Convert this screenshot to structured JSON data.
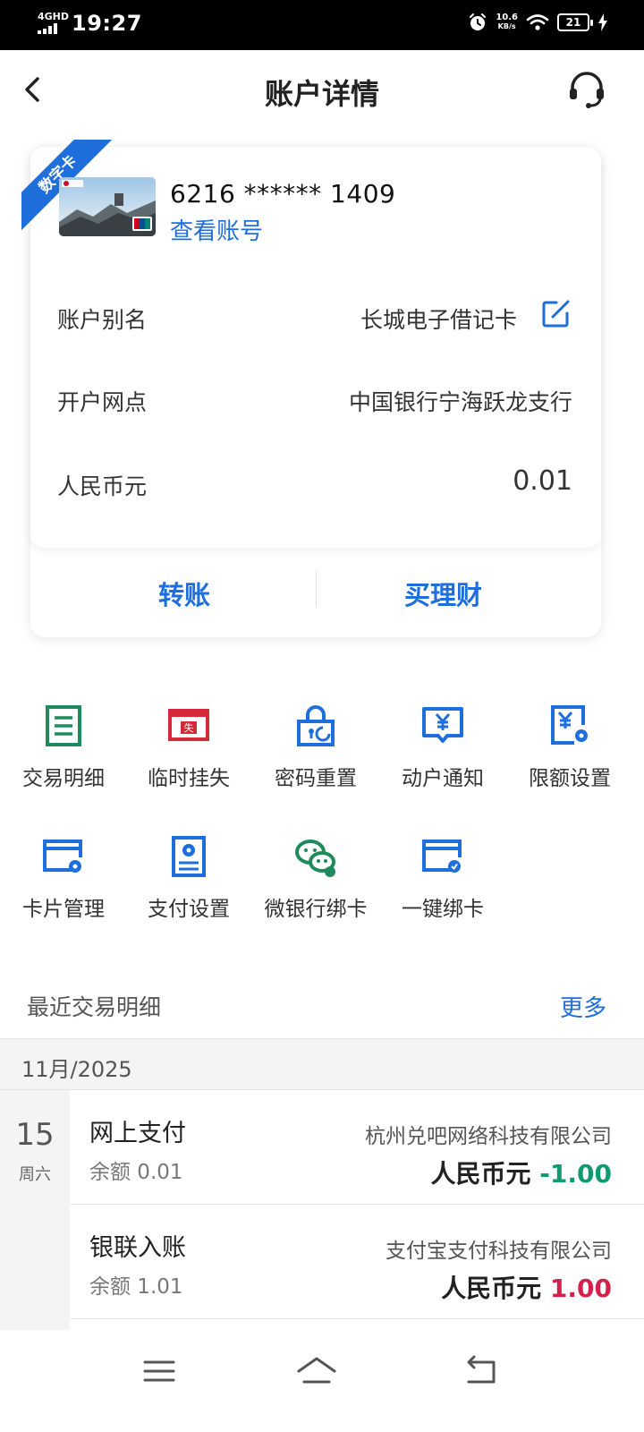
{
  "status_bar": {
    "network": "4GHD",
    "time": "19:27",
    "speed_value": "10.6",
    "speed_unit": "KB/s",
    "battery": "21"
  },
  "header": {
    "title": "账户详情"
  },
  "card": {
    "badge": "数字卡",
    "number": "6216 ****** 1409",
    "view_account": "查看账号",
    "rows": [
      {
        "label": "账户别名",
        "value": "长城电子借记卡"
      },
      {
        "label": "开户网点",
        "value": "中国银行宁海跃龙支行"
      },
      {
        "label": "人民币元",
        "value": "0.01"
      }
    ],
    "actions": {
      "transfer": "转账",
      "buy_wealth": "买理财"
    }
  },
  "functions": [
    {
      "label": "交易明细",
      "icon": "transaction-detail-icon"
    },
    {
      "label": "临时挂失",
      "icon": "temporary-loss-icon"
    },
    {
      "label": "密码重置",
      "icon": "password-reset-icon"
    },
    {
      "label": "动户通知",
      "icon": "account-notice-icon"
    },
    {
      "label": "限额设置",
      "icon": "limit-setting-icon"
    },
    {
      "label": "卡片管理",
      "icon": "card-management-icon"
    },
    {
      "label": "支付设置",
      "icon": "payment-setting-icon"
    },
    {
      "label": "微银行绑卡",
      "icon": "wechat-bind-icon"
    },
    {
      "label": "一键绑卡",
      "icon": "quick-bind-icon"
    }
  ],
  "recent": {
    "title": "最近交易明细",
    "more": "更多",
    "month": "11月/2025",
    "day": "15",
    "weekday": "周六",
    "transactions": [
      {
        "type": "网上支付",
        "balance": "余额 0.01",
        "counterparty": "杭州兑吧网络科技有限公司",
        "currency": "人民币元",
        "amount": "-1.00"
      },
      {
        "type": "银联入账",
        "balance": "余额 1.01",
        "counterparty": "支付宝支付科技有限公司",
        "currency": "人民币元",
        "amount": "1.00"
      }
    ]
  },
  "colors": {
    "accent": "#1e6fdc",
    "green": "#1f8a5b",
    "red": "#d42a3a",
    "negative": "#0f9a70",
    "positive": "#d4204a"
  }
}
